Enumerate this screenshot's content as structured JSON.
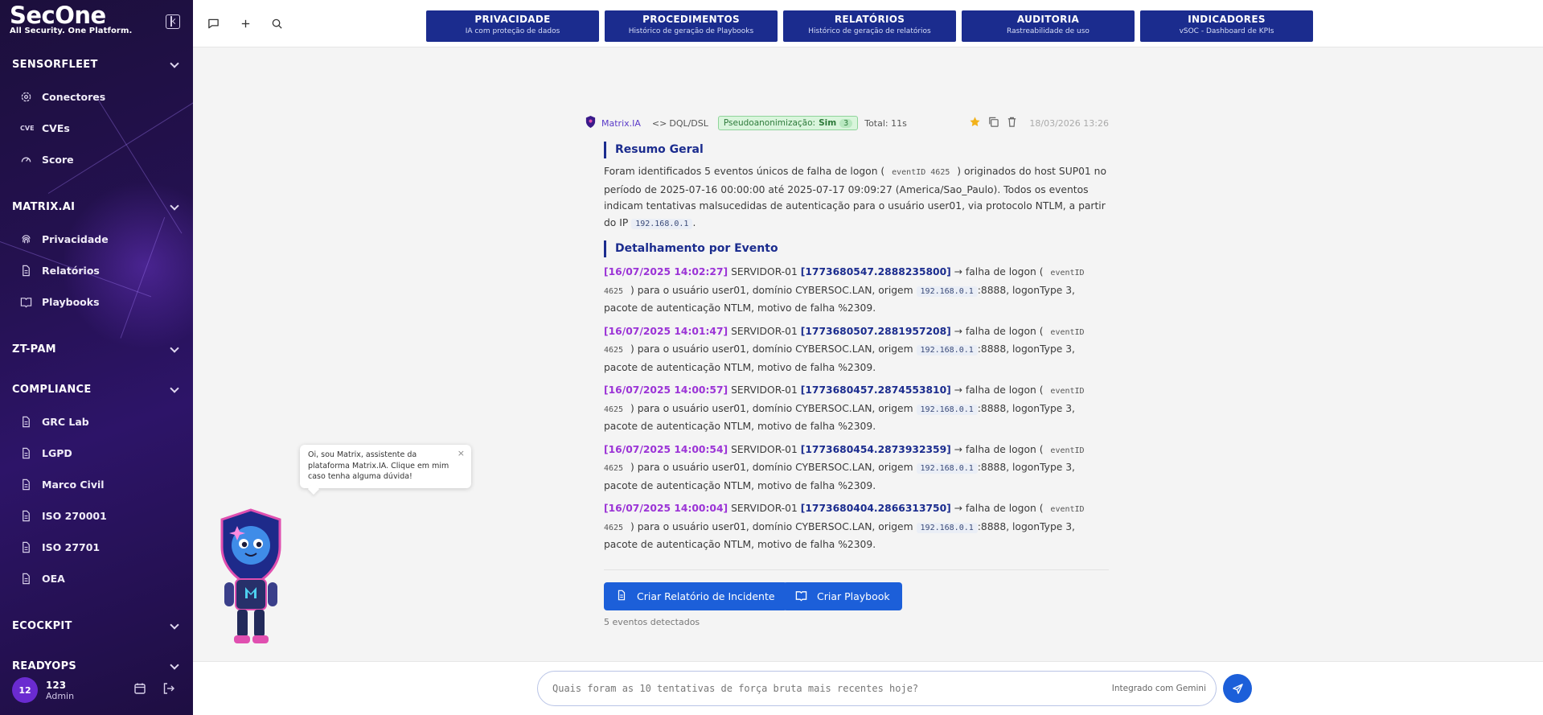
{
  "brand": {
    "name": "SecOne",
    "tagline": "All Security. One Platform."
  },
  "sidebar": {
    "sections": [
      {
        "label": "SENSORFLEET",
        "items": [
          "Conectores",
          "CVEs",
          "Score"
        ]
      },
      {
        "label": "MATRIX.AI",
        "items": [
          "Privacidade",
          "Relatórios",
          "Playbooks"
        ]
      },
      {
        "label": "ZT-PAM",
        "items": []
      },
      {
        "label": "COMPLIANCE",
        "items": [
          "GRC Lab",
          "LGPD",
          "Marco Civil",
          "ISO 270001",
          "ISO 27701",
          "OEA"
        ]
      },
      {
        "label": "ECOCKPIT",
        "items": []
      },
      {
        "label": "READYOPS",
        "items": []
      }
    ],
    "cve_badge": "CVE",
    "user": {
      "initials": "12",
      "name": "123",
      "role": "Admin"
    }
  },
  "topnav": [
    {
      "title": "PRIVACIDADE",
      "subtitle": "IA com proteção de dados"
    },
    {
      "title": "PROCEDIMENTOS",
      "subtitle": "Histórico de geração de Playbooks"
    },
    {
      "title": "RELATÓRIOS",
      "subtitle": "Histórico de geração de relatórios"
    },
    {
      "title": "AUDITORIA",
      "subtitle": "Rastreabilidade de uso"
    },
    {
      "title": "INDICADORES",
      "subtitle": "vSOC - Dashboard de KPIs"
    }
  ],
  "message": {
    "author": "Matrix.IA",
    "query_type": "DQL/DSL",
    "pseudo_label": "Pseudoanonimização:",
    "pseudo_value": "Sim",
    "pseudo_count": "3",
    "total": "Total: 11s",
    "timestamp": "18/03/2026 13:26",
    "summary_title": "Resumo Geral",
    "summary": {
      "a": "Foram identificados 5 eventos únicos de falha de logon (",
      "code1": "eventID 4625",
      "b": ") originados do host SUP01 no período de 2025-07-16 00:00:00 até 2025-07-17 09:09:27 (America/Sao_Paulo). Todos os eventos indicam tentativas malsucedidas de autenticação para o usuário user01, via protocolo NTLM, a partir do IP",
      "ip": "192.168.0.1",
      "c": "."
    },
    "detail_title": "Detalhamento por Evento",
    "event_text": {
      "host": "SERVIDOR-01",
      "arrow": "→ falha de logon (",
      "code": "eventID 4625",
      "mid": ") para o usuário user01, domínio CYBERSOC.LAN, origem",
      "ip": "192.168.0.1",
      "tail": ":8888, logonType 3, pacote de autenticação NTLM, motivo de falha %2309."
    },
    "events": [
      {
        "ts": "[16/07/2025 14:02:27]",
        "id": "[1773680547.2888235800]"
      },
      {
        "ts": "[16/07/2025 14:01:47]",
        "id": "[1773680507.2881957208]"
      },
      {
        "ts": "[16/07/2025 14:00:57]",
        "id": "[1773680457.2874553810]"
      },
      {
        "ts": "[16/07/2025 14:00:54]",
        "id": "[1773680454.2873932359]"
      },
      {
        "ts": "[16/07/2025 14:00:04]",
        "id": "[1773680404.2866313750]"
      }
    ],
    "actions": {
      "incident": "Criar Relatório de Incidente",
      "playbook": "Criar Playbook"
    },
    "detected": "5 eventos detectados"
  },
  "assistant": {
    "tooltip": "Oi, sou Matrix, assistente da plataforma Matrix.IA. Clique em mim caso tenha alguma dúvida!",
    "close": "×"
  },
  "composer": {
    "placeholder": "Quais foram as 10 tentativas de força bruta mais recentes hoje?",
    "integration": "Integrado com Gemini"
  },
  "colors": {
    "nav": "#1b2c8e",
    "accent": "#1c5fd9",
    "timestamp": "#9b34d6",
    "sidebar": "#241150"
  }
}
